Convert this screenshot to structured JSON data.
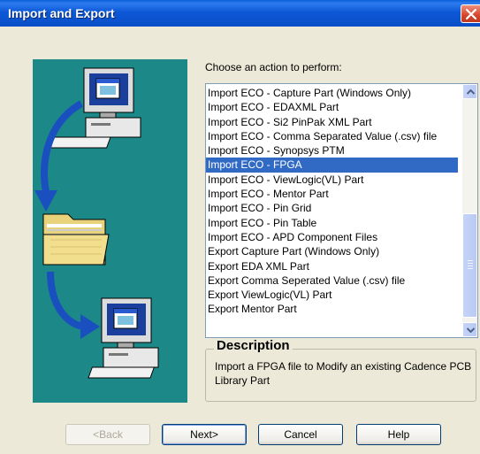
{
  "window": {
    "title": "Import and Export"
  },
  "prompt": "Choose an action to perform:",
  "actions": [
    "Import ECO - Capture Part (Windows Only)",
    "Import ECO - EDAXML Part",
    "Import ECO - Si2 PinPak XML Part",
    "Import ECO - Comma Separated Value (.csv) file",
    "Import ECO - Synopsys PTM",
    "Import ECO - FPGA",
    "Import ECO - ViewLogic(VL) Part",
    "Import ECO -  Mentor Part",
    "Import ECO - Pin Grid",
    "Import ECO - Pin Table",
    "Import ECO - APD Component Files",
    "Export Capture Part (Windows Only)",
    "Export EDA XML Part",
    "Export Comma Seperated Value (.csv) file",
    "Export ViewLogic(VL) Part",
    "Export Mentor Part"
  ],
  "selected_action": "Import ECO - FPGA",
  "description": {
    "title": "Description",
    "text": "Import a FPGA file to Modify an existing Cadence PCB Library Part"
  },
  "buttons": {
    "back": "<Back",
    "next": "Next>",
    "cancel": "Cancel",
    "help": "Help"
  },
  "colors": {
    "titlebar": "#0A52D0",
    "art_panel": "#1C8888",
    "selection": "#316AC5"
  }
}
